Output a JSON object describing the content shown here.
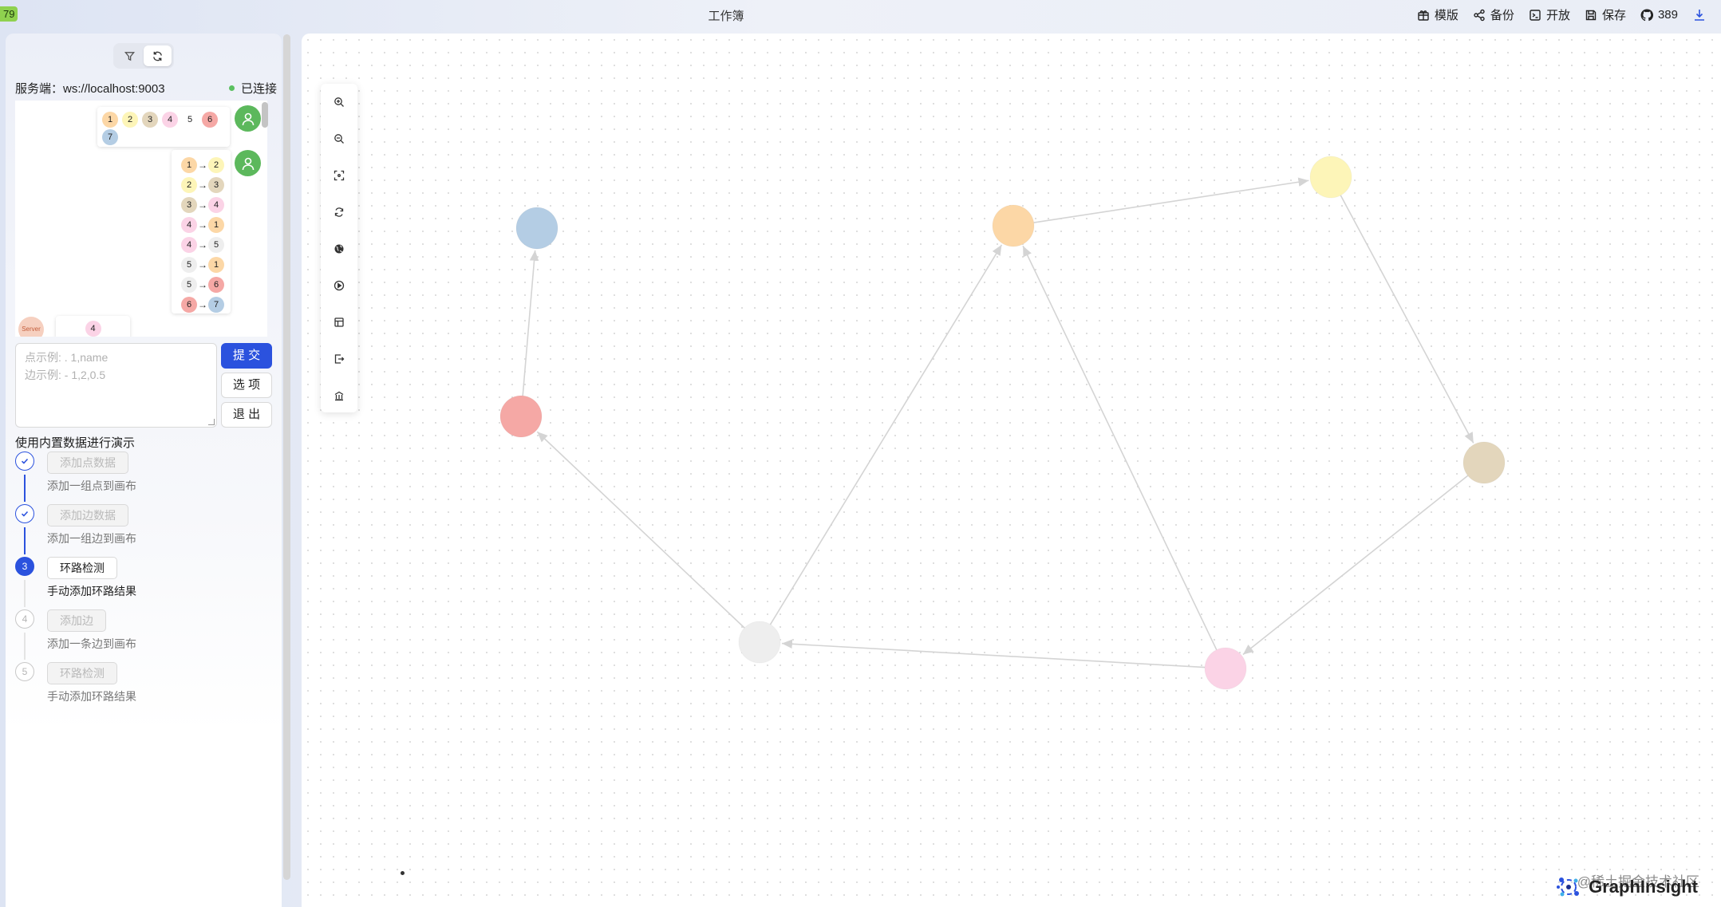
{
  "topbar": {
    "corner_badge": "79",
    "title": "工作簿",
    "actions": [
      {
        "icon": "template-icon",
        "label": "模版"
      },
      {
        "icon": "share-icon",
        "label": "备份"
      },
      {
        "icon": "open-icon",
        "label": "开放"
      },
      {
        "icon": "save-icon",
        "label": "保存"
      },
      {
        "icon": "github-icon",
        "label": "389"
      }
    ],
    "download_icon": "download-icon"
  },
  "sidebar": {
    "toggle": {
      "icons": [
        "filter-icon",
        "refresh-icon"
      ],
      "active": "refresh-icon"
    },
    "server_label": "服务端：ws://localhost:9003",
    "status": "已连接",
    "status_color": "#5ac060",
    "chat": {
      "nodes_message": [
        "1",
        "2",
        "3",
        "4",
        "5",
        "6",
        "7"
      ],
      "edges_message": [
        [
          "1",
          "2"
        ],
        [
          "2",
          "3"
        ],
        [
          "3",
          "4"
        ],
        [
          "4",
          "1"
        ],
        [
          "4",
          "5"
        ],
        [
          "5",
          "1"
        ],
        [
          "5",
          "6"
        ],
        [
          "6",
          "7"
        ]
      ],
      "server_avatar_label": "Server",
      "server_reply": "4"
    },
    "input": {
      "placeholder_line1": "点示例: . 1,name",
      "placeholder_line2": "边示例: - 1,2,0.5"
    },
    "buttons": {
      "submit": "提 交",
      "options": "选 项",
      "exit": "退 出"
    },
    "demo_title": "使用内置数据进行演示",
    "steps": [
      {
        "index": "1",
        "status": "done",
        "button": "添加点数据",
        "desc": "添加一组点到画布"
      },
      {
        "index": "2",
        "status": "done",
        "button": "添加边数据",
        "desc": "添加一组边到画布"
      },
      {
        "index": "3",
        "status": "active",
        "button": "环路检测",
        "desc": "手动添加环路结果"
      },
      {
        "index": "4",
        "status": "pending",
        "button": "添加边",
        "desc": "添加一条边到画布"
      },
      {
        "index": "5",
        "status": "pending",
        "button": "环路检测",
        "desc": "手动添加环路结果"
      }
    ]
  },
  "node_colors": {
    "1": "#fcd7a6",
    "2": "#fdf5b8",
    "3": "#e3d6bc",
    "4": "#fbd3e6",
    "5": "#eeeeee",
    "6": "#f5a8a5",
    "7": "#b4cde4"
  },
  "canvas": {
    "toolbar_icons": [
      "zoom-in-icon",
      "zoom-out-icon",
      "fit-view-icon",
      "rotate-icon",
      "globe-icon",
      "play-icon",
      "layout-icon",
      "export-icon",
      "library-icon"
    ],
    "graph": {
      "nodes": [
        {
          "id": "1",
          "color": "#fcd7a6"
        },
        {
          "id": "2",
          "color": "#fdf5b8"
        },
        {
          "id": "3",
          "color": "#e3d6bc"
        },
        {
          "id": "4",
          "color": "#fbd3e6"
        },
        {
          "id": "5",
          "color": "#eeeeee"
        },
        {
          "id": "6",
          "color": "#f5a8a5"
        },
        {
          "id": "7",
          "color": "#b4cde4"
        }
      ],
      "edges": [
        [
          "1",
          "2"
        ],
        [
          "2",
          "3"
        ],
        [
          "3",
          "4"
        ],
        [
          "4",
          "1"
        ],
        [
          "4",
          "5"
        ],
        [
          "5",
          "1"
        ],
        [
          "5",
          "6"
        ],
        [
          "6",
          "7"
        ]
      ],
      "edge_color": "#d4d4d4"
    },
    "watermark": "@稀土掘金技术社区",
    "brand": "GraphInsight",
    "brand_icon": "graphinsight-logo-icon"
  }
}
